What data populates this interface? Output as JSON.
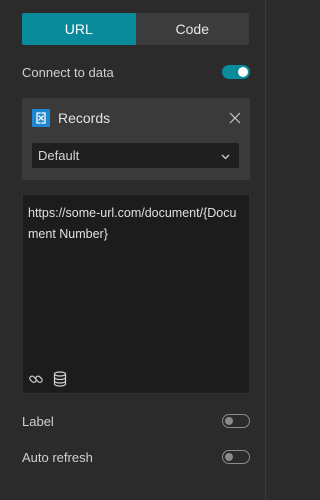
{
  "mode_tabs": {
    "url_label": "URL",
    "code_label": "Code",
    "active": "URL"
  },
  "connect_to_data": {
    "label": "Connect to data",
    "enabled": true
  },
  "data_source": {
    "name": "Records",
    "icon": "records-icon",
    "view_select": {
      "value": "Default"
    }
  },
  "url_editor": {
    "value": "https://some-url.com/document/{Document Number}",
    "tools": [
      "link-icon",
      "database-icon"
    ]
  },
  "label_setting": {
    "label": "Label",
    "enabled": false
  },
  "auto_refresh": {
    "label": "Auto refresh",
    "enabled": false
  },
  "colors": {
    "accent": "#0a8b9b",
    "panel_bg": "#2b2b2b",
    "card_bg": "#3a3a3a",
    "editor_bg": "#1c1c1c",
    "records_icon_bg": "#1d88d1"
  }
}
